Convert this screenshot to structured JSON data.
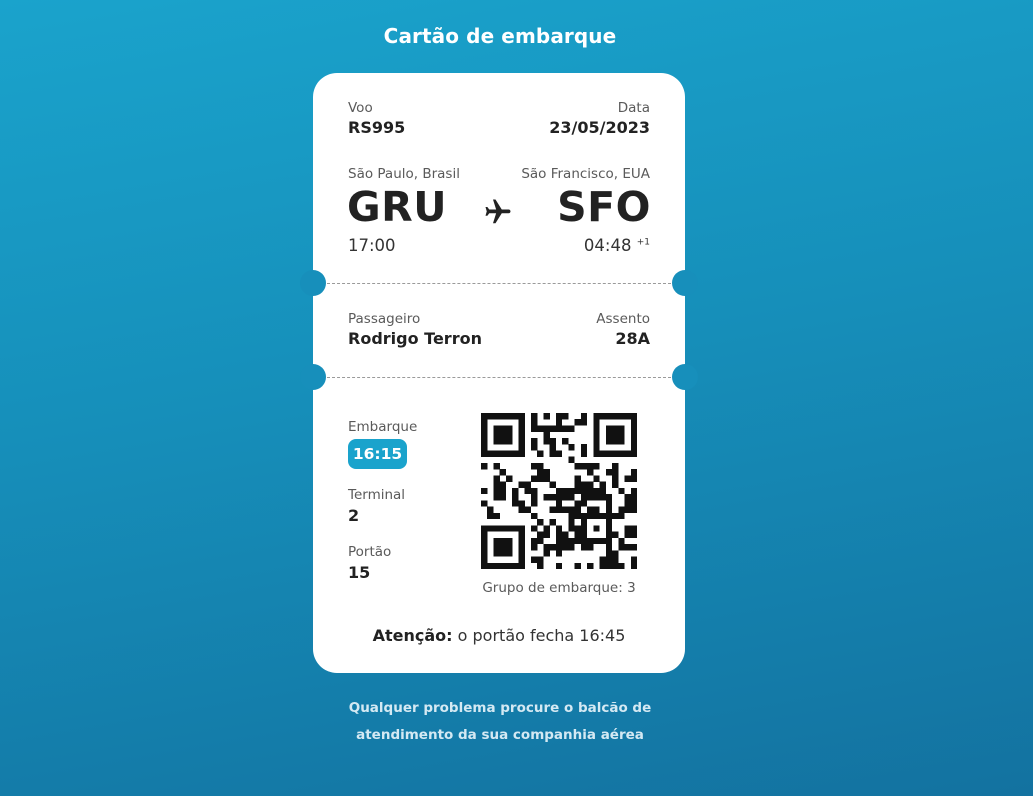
{
  "page": {
    "title": "Cartão de embarque"
  },
  "flight": {
    "label": "Voo",
    "value": "RS995"
  },
  "date": {
    "label": "Data",
    "value": "23/05/2023"
  },
  "origin": {
    "city": "São Paulo, Brasil",
    "code": "GRU",
    "time": "17:00"
  },
  "destination": {
    "city": "São Francisco, EUA",
    "code": "SFO",
    "time": "04:48",
    "day_offset": "+1"
  },
  "passenger": {
    "label": "Passageiro",
    "value": "Rodrigo Terron"
  },
  "seat": {
    "label": "Assento",
    "value": "28A"
  },
  "boarding": {
    "label": "Embarque",
    "value": "16:15"
  },
  "terminal": {
    "label": "Terminal",
    "value": "2"
  },
  "gate": {
    "label": "Portão",
    "value": "15"
  },
  "boarding_group": "Grupo de embarque: 3",
  "attention": {
    "label": "Atenção:",
    "text": "o portão fecha 16:45"
  },
  "footer": {
    "line1": "Qualquer problema procure o balcão de",
    "line2": "atendimento da sua companhia aérea"
  },
  "icons": {
    "flight": "airplane-icon",
    "qr": "qr-code"
  },
  "colors": {
    "accent": "#1aa3cc",
    "background_top": "#1aa3cc",
    "background_bottom": "#1372a0"
  }
}
